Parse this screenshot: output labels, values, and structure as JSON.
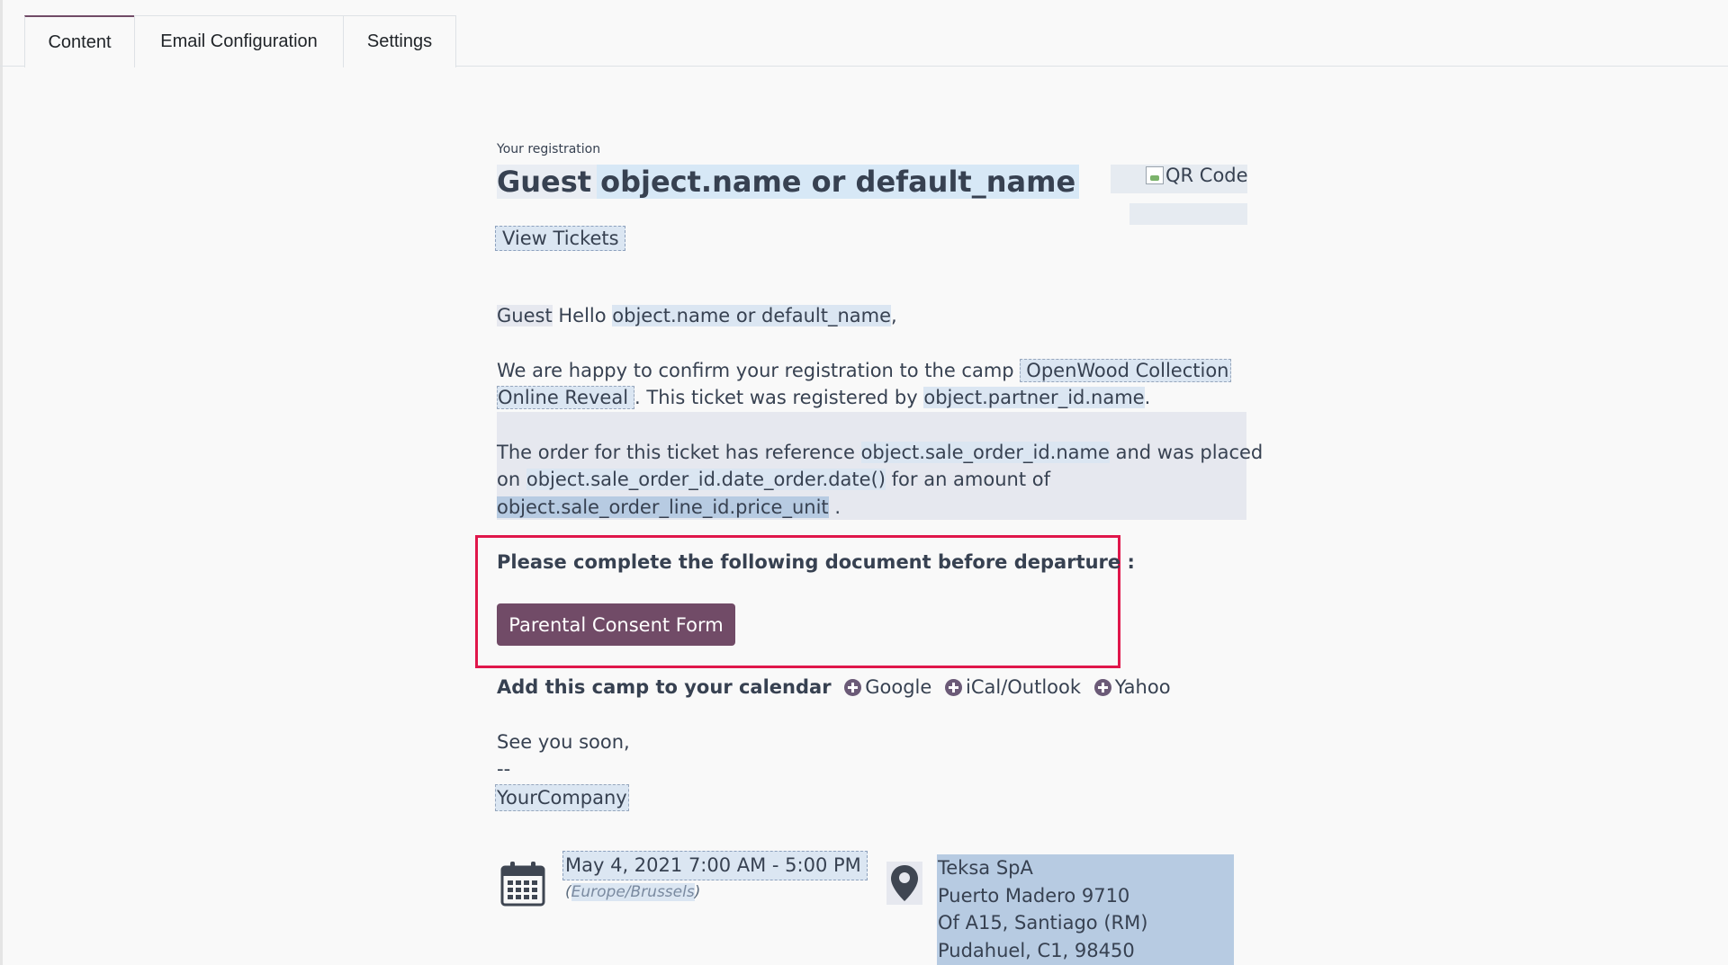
{
  "tabs": [
    {
      "label": "Content",
      "active": true
    },
    {
      "label": "Email Configuration",
      "active": false
    },
    {
      "label": "Settings",
      "active": false
    }
  ],
  "header": {
    "small_label": "Your registration",
    "title_prefix": "Guest",
    "title_var": "object.name or default_name",
    "qr_alt": "QR Code",
    "view_tickets": "View Tickets"
  },
  "greeting": {
    "guest": "Guest",
    "hello": " Hello ",
    "name_var": "object.name or default_name",
    "comma": ","
  },
  "confirm": {
    "text1": "We are happy to confirm your registration to the camp ",
    "camp_name_line1": "OpenWood Collection",
    "camp_name_line2": "Online Reveal",
    "text2": ". This ticket was registered by ",
    "partner_var": "object.partner_id.name",
    "text3": "."
  },
  "order": {
    "text1": "The order for this ticket has reference ",
    "ref_var": "object.sale_order_id.name",
    "text2": " and was placed",
    "text3": "on ",
    "date_var": "object.sale_order_id.date_order.date()",
    "text4": " for an amount of",
    "price_var": "object.sale_order_line_id.price_unit",
    "text5": " ."
  },
  "document": {
    "heading": "Please complete the following document before departure :",
    "button": "Parental Consent Form"
  },
  "calendar": {
    "label": "Add this camp to your calendar",
    "google": "Google",
    "ical": "iCal/Outlook",
    "yahoo": "Yahoo"
  },
  "signoff": {
    "line1": "See you soon,",
    "line2": "--",
    "company": "YourCompany"
  },
  "event": {
    "date": "May 4, 2021",
    "time": "7:00 AM - 5:00 PM",
    "tz_open": "(",
    "timezone": "Europe/Brussels",
    "tz_close": ")",
    "address": [
      "Teksa SpA",
      "Puerto Madero 9710",
      "Of A15, Santiago (RM)",
      "Pudahuel, C1, 98450"
    ]
  },
  "colors": {
    "accent": "#714b67",
    "highlight_box": "#e0174b"
  }
}
